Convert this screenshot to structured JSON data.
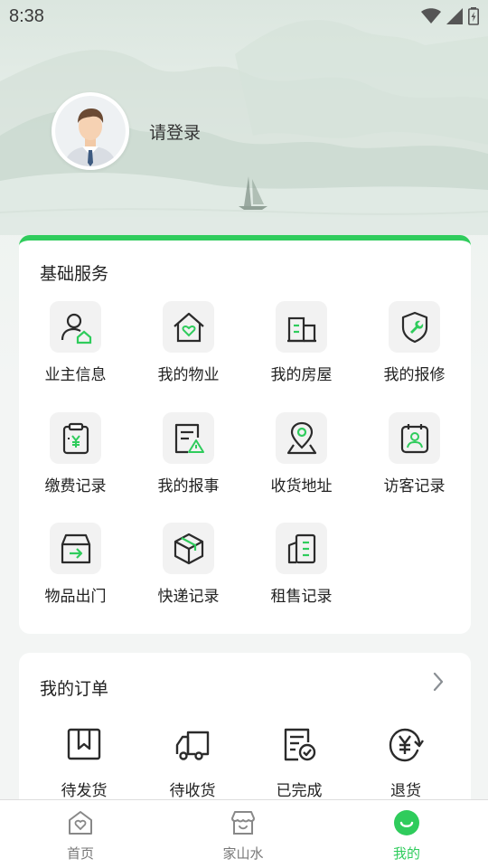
{
  "status_bar": {
    "time": "8:38"
  },
  "profile": {
    "login_prompt": "请登录"
  },
  "services": {
    "title": "基础服务",
    "items": [
      {
        "label": "业主信息",
        "icon": "owner-info-icon"
      },
      {
        "label": "我的物业",
        "icon": "property-icon"
      },
      {
        "label": "我的房屋",
        "icon": "building-icon"
      },
      {
        "label": "我的报修",
        "icon": "repair-icon"
      },
      {
        "label": "缴费记录",
        "icon": "payment-record-icon"
      },
      {
        "label": "我的报事",
        "icon": "report-icon"
      },
      {
        "label": "收货地址",
        "icon": "address-icon"
      },
      {
        "label": "访客记录",
        "icon": "visitor-record-icon"
      },
      {
        "label": "物品出门",
        "icon": "item-exit-icon"
      },
      {
        "label": "快递记录",
        "icon": "express-icon"
      },
      {
        "label": "租售记录",
        "icon": "rent-sale-icon"
      }
    ]
  },
  "orders": {
    "title": "我的订单",
    "items": [
      {
        "label": "待发货",
        "icon": "to-ship-icon"
      },
      {
        "label": "待收货",
        "icon": "to-receive-icon"
      },
      {
        "label": "已完成",
        "icon": "completed-icon"
      },
      {
        "label": "退货",
        "icon": "refund-icon"
      }
    ]
  },
  "tabbar": {
    "items": [
      {
        "label": "首页",
        "icon": "home-icon",
        "active": false
      },
      {
        "label": "家山水",
        "icon": "store-icon",
        "active": false
      },
      {
        "label": "我的",
        "icon": "smile-icon",
        "active": true
      }
    ]
  },
  "colors": {
    "accent": "#2fcc5c",
    "icon_stroke": "#2b2b2b"
  }
}
